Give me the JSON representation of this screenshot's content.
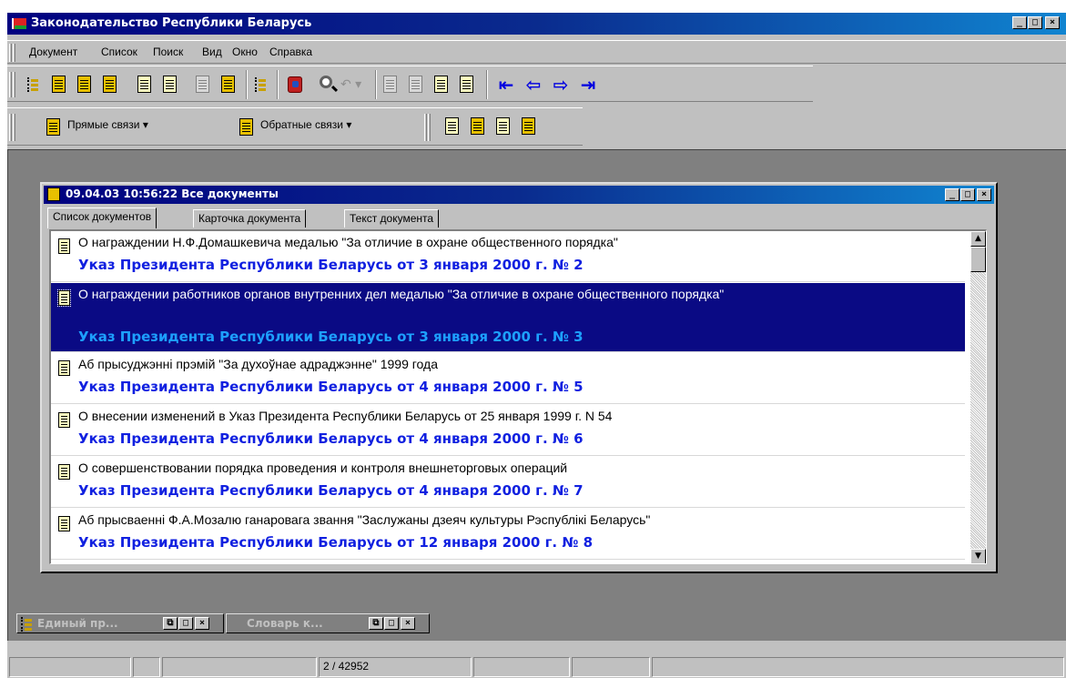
{
  "app": {
    "title": "Законодательство Республики Беларусь",
    "window_controls": {
      "minimize": "_",
      "maximize": "□",
      "close": "×"
    }
  },
  "menu": [
    {
      "label": "Документ"
    },
    {
      "label": "Список"
    },
    {
      "label": "Поиск"
    },
    {
      "label": "Вид"
    },
    {
      "label": "Окно"
    },
    {
      "label": "Справка"
    }
  ],
  "toolbar2": {
    "direct_links": "Прямые связи",
    "reverse_links": "Обратные связи",
    "dropdown_arrow": "▾"
  },
  "doc_window": {
    "title": "09.04.03 10:56:22 Все документы",
    "tabs": [
      {
        "label": "Список документов"
      },
      {
        "label": "Карточка документа"
      },
      {
        "label": "Текст документа"
      }
    ],
    "selected_index": 1,
    "rows": [
      {
        "title": "О награждении Н.Ф.Домашкевича медалью \"За отличие в охране общественного порядка\"",
        "subtitle": "Указ Президента Республики Беларусь от 3 января 2000 г. № 2"
      },
      {
        "title": "О награждении работников органов внутренних дел медалью \"За отличие в охране общественного порядка\"",
        "subtitle": "Указ Президента Республики Беларусь от 3 января 2000 г. № 3"
      },
      {
        "title": "Аб прысуджэнні прэмій \"За духоўнае адраджэнне\" 1999 года",
        "subtitle": "Указ Президента Республики Беларусь от 4 января 2000 г. № 5"
      },
      {
        "title": "О внесении изменений в Указ Президента Республики Беларусь от 25 января 1999 г. N 54",
        "subtitle": "Указ Президента Республики Беларусь от 4 января 2000 г. № 6"
      },
      {
        "title": "О совершенствовании порядка проведения и контроля внешнеторговых операций",
        "subtitle": "Указ Президента Республики Беларусь от 4 января 2000 г. № 7"
      },
      {
        "title": "Аб прысваенні Ф.А.Мозалю ганаровага звання \"Заслужаны дзеяч культуры Рэспублікі Беларусь\"",
        "subtitle": "Указ Президента Республики Беларусь от 12 января 2000 г. № 8"
      }
    ]
  },
  "minimized": [
    {
      "label": "Единый пр..."
    },
    {
      "label": "Словарь к..."
    }
  ],
  "status": {
    "position": "2 / 42952"
  },
  "colors": {
    "selection": "#0a0a84",
    "link_blue": "#1020e0",
    "titlebar": "#000080"
  }
}
